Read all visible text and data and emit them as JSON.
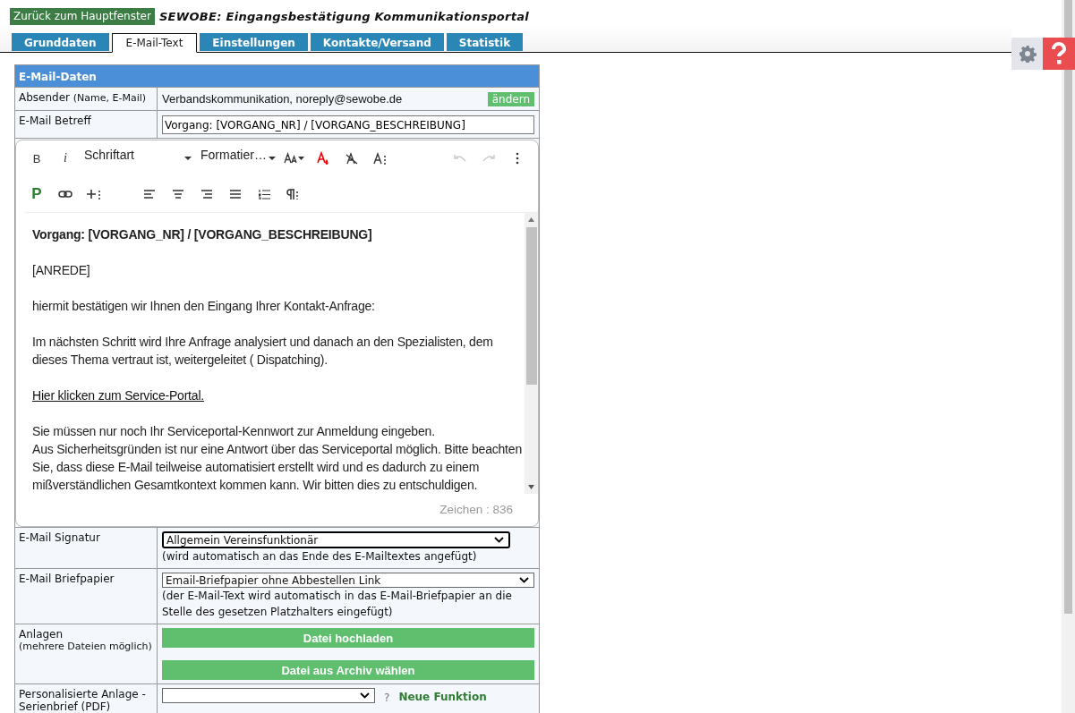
{
  "header": {
    "back_button": "Zurück zum Hauptfenster",
    "title": "SEWOBE: Eingangsbestätigung Kommunikationsportal"
  },
  "tabs": [
    {
      "label": "Grunddaten",
      "selected": false
    },
    {
      "label": "E-Mail-Text",
      "selected": true
    },
    {
      "label": "Einstellungen",
      "selected": false
    },
    {
      "label": "Kontakte/Versand",
      "selected": false
    },
    {
      "label": "Statistik",
      "selected": false
    }
  ],
  "section_title": "E-Mail-Daten",
  "sender": {
    "label": "Absender",
    "label_hint": "(Name, E-Mail)",
    "value": "Verbandskommunikation, noreply@sewobe.de",
    "button": "ändern"
  },
  "subject": {
    "label": "E-Mail Betreff",
    "value": "Vorgang: [VORGANG_NR] / [VORGANG_BESCHREIBUNG]"
  },
  "editor": {
    "toolbar": {
      "bold": "B",
      "italic": "i",
      "font_select": "Schriftart",
      "format_select": "Formatier…",
      "paragraph": "P",
      "undo_disabled": true,
      "redo_disabled": true
    },
    "paragraphs": [
      {
        "kind": "heading",
        "text": "Vorgang: [VORGANG_NR] / [VORGANG_BESCHREIBUNG]"
      },
      {
        "kind": "text",
        "text": "[ANREDE]"
      },
      {
        "kind": "text",
        "text": "hiermit bestätigen wir Ihnen den Eingang Ihrer Kontakt-Anfrage:"
      },
      {
        "kind": "text",
        "text": "Im nächsten Schritt wird Ihre Anfrage analysiert und danach an den Spezialisten, dem dieses Thema vertraut ist, weitergeleitet ( Dispatching)."
      },
      {
        "kind": "link",
        "text": "Hier klicken zum Service-Portal."
      },
      {
        "kind": "text",
        "text": "Sie müssen nur noch Ihr Serviceportal-Kennwort zur Anmeldung eingeben.\nAus Sicherheitsgründen ist nur eine Antwort über das Serviceportal möglich. Bitte beachten Sie, dass diese E-Mail teilweise automatisiert erstellt wird und es dadurch zu einem mißverständlichen Gesamtkontext kommen kann. Wir bitten dies zu entschuldigen."
      }
    ],
    "char_count": "Zeichen : 836"
  },
  "signature": {
    "label": "E-Mail Signatur",
    "value": "Allgemein Vereinsfunktionär",
    "hint": "(wird automatisch an das Ende des E-Mailtextes angefügt)"
  },
  "stationery": {
    "label": "E-Mail Briefpapier",
    "value": "Email-Briefpapier ohne Abbestellen Link",
    "hint": "(der E-Mail-Text wird automatisch in das E-Mail-Briefpapier an die Stelle des gesetzen Platzhalters eingefügt)"
  },
  "attachments": {
    "label": "Anlagen",
    "hint": "(mehrere Dateien möglich)",
    "upload_button": "Datei hochladen",
    "archive_button": "Datei aus Archiv wählen"
  },
  "personalized": {
    "label": "Personalisierte Anlage - Serienbrief (PDF)",
    "help": "?",
    "new_feature": "Neue Funktion"
  }
}
